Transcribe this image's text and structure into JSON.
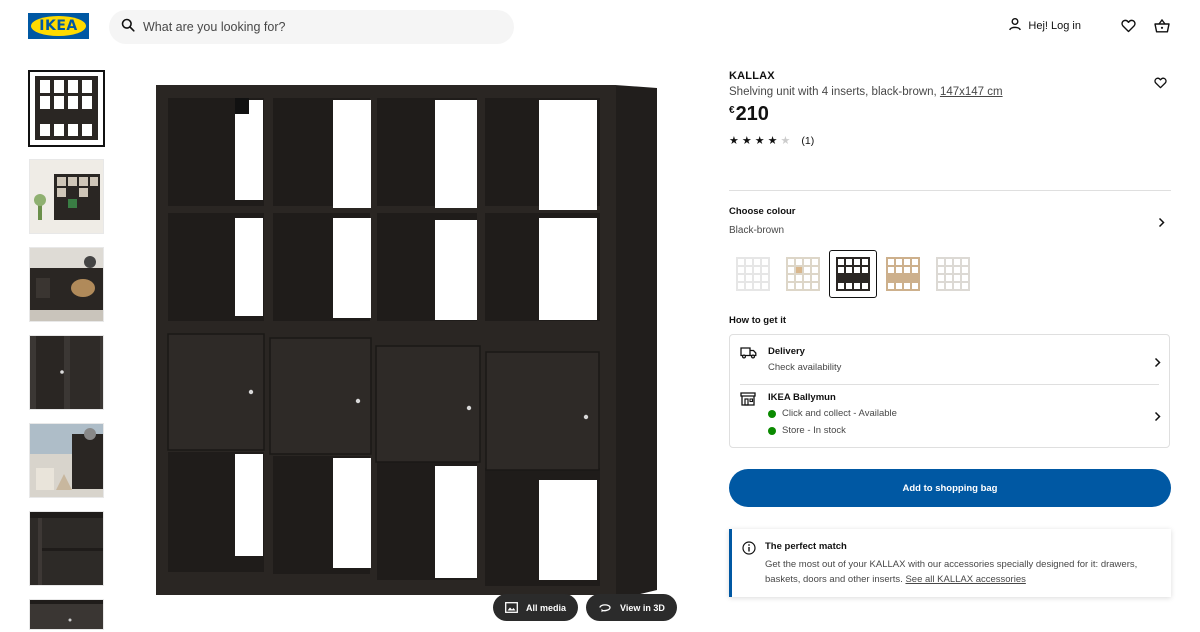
{
  "header": {
    "logo_text": "IKEA",
    "search_placeholder": "What are you looking for?",
    "login_label": "Hej! Log in"
  },
  "media": {
    "all_media_label": "All media",
    "view_3d_label": "View in 3D"
  },
  "product": {
    "name": "KALLAX",
    "description": "Shelving unit with 4 inserts, black-brown, ",
    "size_link": "147x147 cm",
    "currency": "€",
    "price": "210",
    "rating": 4,
    "rating_max": 5,
    "rating_count": "(1)"
  },
  "colour": {
    "label": "Choose colour",
    "value": "Black-brown",
    "swatches": [
      {
        "name": "white",
        "color": "#ececec"
      },
      {
        "name": "white-oak",
        "color": "#e9ddc9"
      },
      {
        "name": "black-brown",
        "color": "#2a2623"
      },
      {
        "name": "oak-effect",
        "color": "#cdb08c"
      },
      {
        "name": "white-stained-oak",
        "color": "#e4e1dc"
      }
    ]
  },
  "delivery": {
    "heading": "How to get it",
    "delivery_title": "Delivery",
    "delivery_sub": "Check availability",
    "store_title": "IKEA Ballymun",
    "store_line1": "Click and collect - Available",
    "store_line2": "Store - In stock"
  },
  "cta": {
    "add_label": "Add to shopping bag"
  },
  "match": {
    "title": "The perfect match",
    "text": "Get the most out of your KALLAX with our accessories specially designed for it: drawers, baskets, doors and other inserts. ",
    "link": "See all KALLAX accessories"
  },
  "colors": {
    "brand_blue": "#0058a3",
    "brand_yellow": "#ffdb00",
    "stock_green": "#0a8a00",
    "shelf_dark": "#2a2623"
  }
}
